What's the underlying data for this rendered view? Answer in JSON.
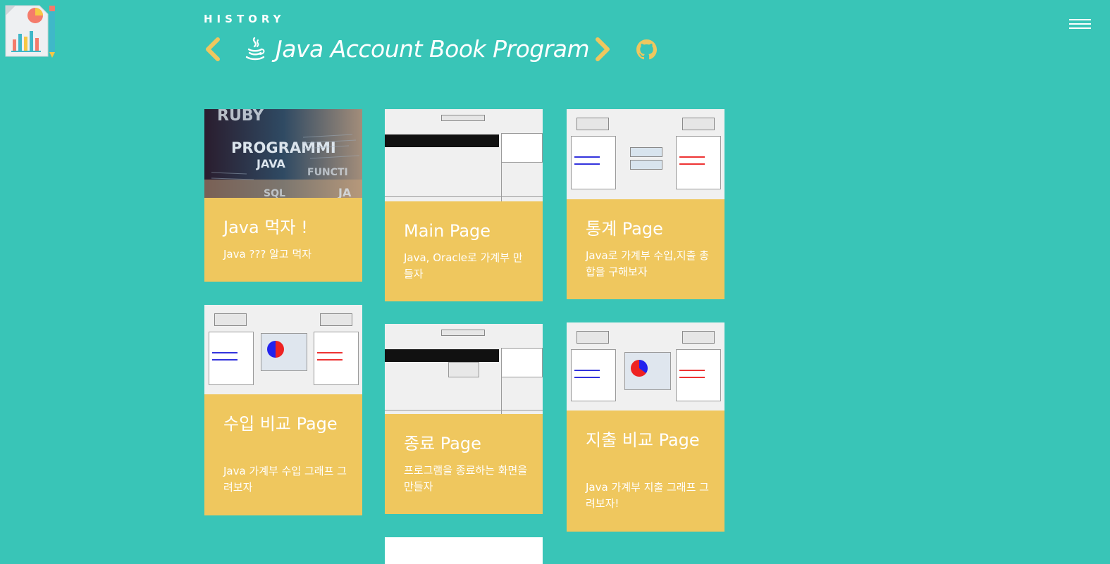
{
  "header": {
    "section_label": "HISTORY",
    "title": "Java Account Book Program",
    "icons": {
      "logo": "report-chart-icon",
      "prev": "chevron-left-icon",
      "next": "chevron-right-icon",
      "java": "java-icon",
      "github": "github-icon",
      "menu": "hamburger-menu-icon"
    }
  },
  "colors": {
    "background": "#39c5b7",
    "card_info": "#efc75e",
    "accent_arrow": "#efc75e",
    "text": "#ffffff"
  },
  "cards": [
    {
      "title": "Java 먹자 !",
      "desc": "Java ??? 알고 먹자"
    },
    {
      "title": "Main Page",
      "desc": "Java, Oracle로 가계부 만들자"
    },
    {
      "title": "통계 Page",
      "desc": "Java로 가계부 수입,지출 총합을 구해보자"
    },
    {
      "title": "수입 비교 Page",
      "desc": "Java 가계부 수입 그래프 그려보자"
    },
    {
      "title": "종료 Page",
      "desc": "프로그램을 종료하는 화면을 만들자"
    },
    {
      "title": "지출 비교 Page",
      "desc": "Java 가계부 지출 그래프 그려보자!"
    }
  ]
}
